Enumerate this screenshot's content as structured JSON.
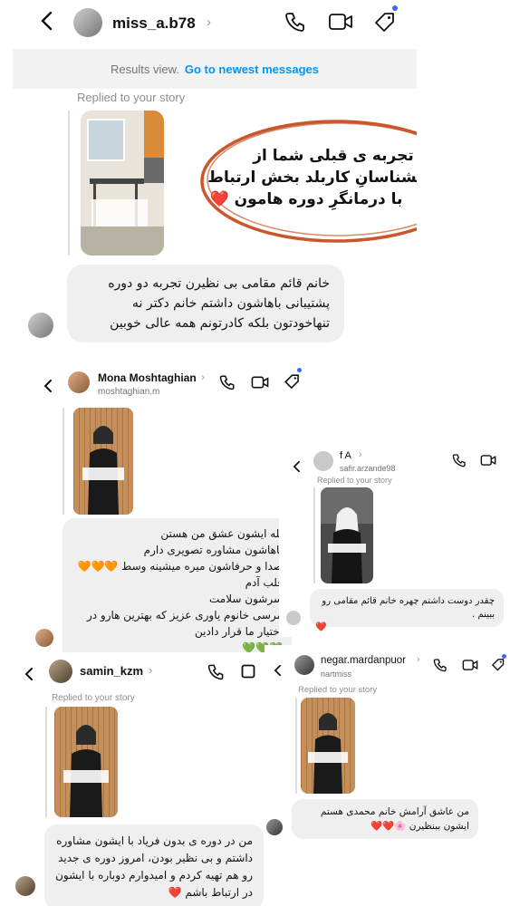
{
  "colors": {
    "accent_blue": "#0095f6",
    "ring": "#c8572b",
    "heart": "#e0245e",
    "bubble": "#efefef"
  },
  "p1": {
    "username": "miss_a.b78",
    "results_text": "Results view.",
    "newest_link": "Go to newest messages",
    "replied": "Replied to your story",
    "overlay_lines": [
      "تجربه ی قبلی شما از",
      "روانشناسانِ کاربلد بخش ارتباط",
      "با درمانگرِ دوره هامون ❤️"
    ],
    "message": "خانم قائم مقامی بی نظیرن تجربه دو دوره پشتیبانی باهاشون داشتم خانم دکتر نه تنهاخودتون بلکه کادرتونم همه عالی خوبین"
  },
  "p2": {
    "username": "Mona Moshtaghian",
    "handle": "moshtaghian.m",
    "message_lines": [
      "بله ایشون عشق من هستن",
      "باهاشون مشاوره تصویری دارم",
      "صدا و حرفاشون میره میشینه وسط 🧡🧡🧡",
      "قلب آدم",
      "سرشون سلامت",
      "مرسی خانوم یاوری عزیز که بهترین هارو در",
      "اختیار ما قرار دادین",
      "💚💚💚"
    ]
  },
  "p3": {
    "username": "f A",
    "handle": "safir.arzande98",
    "replied": "Replied to your story",
    "message": "چقدر دوست داشتم چهره خانم قائم مقامی رو ببینم .",
    "reaction": "❤️"
  },
  "p4": {
    "username": "samin_kzm",
    "replied": "Replied to your story",
    "message": "من در دوره ی بدون فریاد با ایشون مشاوره داشتم و بی نظیر بودن، امروز دوره ی جدید رو هم تهیه کردم و امیدوارم دوباره با ایشون در ارتباط باشم ❤️"
  },
  "p5": {
    "username": "negar.mardanpuor",
    "handle": "nartmiss",
    "replied": "Replied to your story",
    "message": "من عاشق آرامش خانم محمدی هستم ایشون ببنظیرن 🌸❤️❤️"
  }
}
